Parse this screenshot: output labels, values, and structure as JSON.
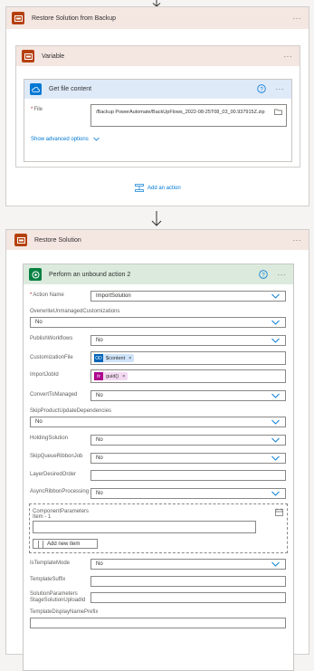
{
  "scope_backup": {
    "title": "Restore Solution from Backup"
  },
  "scope_variable": {
    "title": "Variable"
  },
  "get_file": {
    "title": "Get file content",
    "file_label": "File",
    "file_value": "/Backup PowerAutomate/BackUpFlows_2022-08-25T08_03_00.937915Z.zip",
    "advanced": "Show advanced options"
  },
  "add_action": "Add an action",
  "scope_restore": {
    "title": "Restore Solution"
  },
  "unbound": {
    "title": "Perform an unbound action 2",
    "fields": {
      "action_name": {
        "label": "Action Name",
        "value": "ImportSolution"
      },
      "overwrite": {
        "label": "OverwriteUnmanagedCustomizations",
        "value": "No"
      },
      "publish": {
        "label": "PublishWorkflows",
        "value": "No"
      },
      "customization": {
        "label": "CustomizationFile",
        "token": "$content"
      },
      "importjob": {
        "label": "ImportJobId",
        "token": "guid()"
      },
      "convert": {
        "label": "ConvertToManaged",
        "value": "No"
      },
      "skip_deps": {
        "label": "SkipProductUpdateDependencies",
        "value": "No"
      },
      "holding": {
        "label": "HoldingSolution",
        "value": "No"
      },
      "skip_queue": {
        "label": "SkipQueueRibbonJob",
        "value": "No"
      },
      "layer": {
        "label": "LayerDesiredOrder",
        "value": ""
      },
      "async": {
        "label": "AsyncRibbonProcessing",
        "value": "No"
      },
      "component": {
        "label": "ComponentParameters",
        "sublabel": "Item - 1",
        "add_item": "Add new item"
      },
      "template_mode": {
        "label": "IsTemplateMode",
        "value": "No"
      },
      "template_suffix": {
        "label": "TemplateSuffix",
        "value": ""
      },
      "solution_params": {
        "label": "SolutionParameters StageSolutionUploadId",
        "value": ""
      },
      "template_display": {
        "label": "TemplateDisplayNamePrefix",
        "value": ""
      }
    }
  },
  "colors": {
    "scope": "#b5400e",
    "http": "#0078d4",
    "dataverse": "#088142",
    "dots": "#605e5c"
  }
}
